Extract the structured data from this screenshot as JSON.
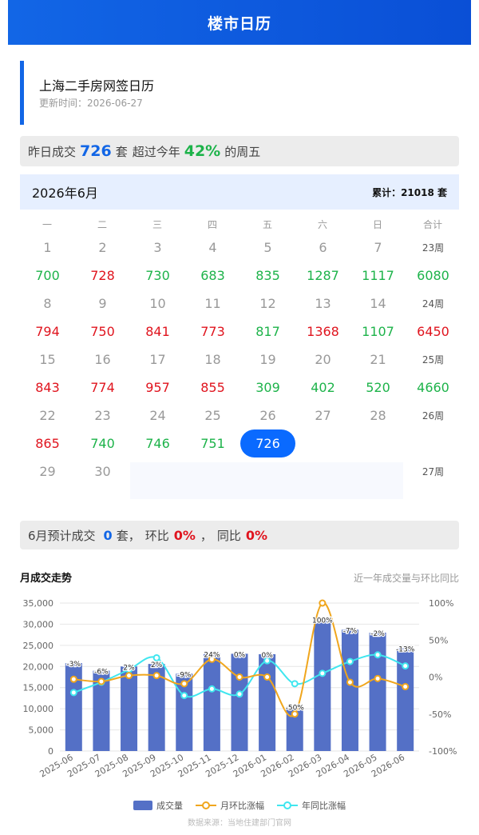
{
  "header": {
    "title": "楼市日历"
  },
  "title_card": {
    "title": "上海二手房网签日历",
    "updated": "更新时间：2026-06-27"
  },
  "summary": {
    "prefix": "昨日成交",
    "count": "726",
    "unit": "套",
    "mid": "超过今年",
    "percent": "42%",
    "suffix": "的周五"
  },
  "calendar": {
    "month": "2026年6月",
    "total": "累计：21018 套",
    "weekdays": [
      "一",
      "二",
      "三",
      "四",
      "五",
      "六",
      "日",
      "合计"
    ],
    "weeks": [
      {
        "days": [
          "1",
          "2",
          "3",
          "4",
          "5",
          "6",
          "7"
        ],
        "label": "23周",
        "values": [
          "700",
          "728",
          "730",
          "683",
          "835",
          "1287",
          "1117",
          "6080"
        ],
        "colors": [
          "green",
          "red",
          "green",
          "green",
          "green",
          "green",
          "green",
          "green"
        ]
      },
      {
        "days": [
          "8",
          "9",
          "10",
          "11",
          "12",
          "13",
          "14"
        ],
        "label": "24周",
        "values": [
          "794",
          "750",
          "841",
          "773",
          "817",
          "1368",
          "1107",
          "6450"
        ],
        "colors": [
          "red",
          "red",
          "red",
          "red",
          "green",
          "red",
          "green",
          "red"
        ]
      },
      {
        "days": [
          "15",
          "16",
          "17",
          "18",
          "19",
          "20",
          "21"
        ],
        "label": "25周",
        "values": [
          "843",
          "774",
          "957",
          "855",
          "309",
          "402",
          "520",
          "4660"
        ],
        "colors": [
          "red",
          "red",
          "red",
          "red",
          "green",
          "green",
          "green",
          "green"
        ]
      },
      {
        "days": [
          "22",
          "23",
          "24",
          "25",
          "26",
          "27",
          "28"
        ],
        "label": "26周",
        "values": [
          "865",
          "740",
          "746",
          "751",
          "726",
          "",
          "",
          ""
        ],
        "colors": [
          "red",
          "green",
          "green",
          "green",
          "selected",
          "",
          "",
          ""
        ]
      },
      {
        "days": [
          "29",
          "30",
          "",
          "",
          "",
          "",
          "",
          ""
        ],
        "label": "27周",
        "values": [],
        "colors": []
      }
    ]
  },
  "forecast": {
    "prefix": "6月预计成交",
    "count": "0",
    "unit": "套，",
    "mom_label": "环比",
    "mom": "0%",
    "sep": "，",
    "yoy_label": "同比",
    "yoy": "0%"
  },
  "chart_section": {
    "title": "月成交走势",
    "subtitle": "近一年成交量与环比同比"
  },
  "chart_data": {
    "type": "bar",
    "categories": [
      "2025-06",
      "2025-07",
      "2025-08",
      "2025-09",
      "2025-10",
      "2025-11",
      "2025-12",
      "2026-01",
      "2026-02",
      "2026-03",
      "2026-04",
      "2026-05",
      "2026-06"
    ],
    "series": [
      {
        "name": "成交量",
        "type": "bar",
        "values": [
          20800,
          19000,
          20000,
          20600,
          18300,
          23000,
          23000,
          22900,
          10500,
          31100,
          28700,
          28000,
          24300
        ]
      },
      {
        "name": "月环比涨幅",
        "type": "line",
        "axis": "right",
        "values": [
          -3,
          -6,
          2,
          2,
          -9,
          24,
          0,
          0,
          -50,
          100,
          -7,
          -2,
          -13
        ]
      },
      {
        "name": "年同比涨幅",
        "type": "line",
        "axis": "right",
        "values": [
          -21,
          -7,
          10,
          26,
          -25,
          -16,
          -23,
          22,
          -9,
          5,
          21,
          30,
          15
        ]
      }
    ],
    "bar_labels": [
      "-3%",
      "-6%",
      "2%",
      "2%",
      "-9%",
      "24%",
      "0%",
      "0%",
      "-50%",
      "100%",
      "-7%",
      "-2%",
      "-13%"
    ],
    "yticks_left": [
      "35,000",
      "30,000",
      "25,000",
      "20,000",
      "15,000",
      "10,000",
      "5,000",
      "0"
    ],
    "yticks_right": [
      "100%",
      "50%",
      "0%",
      "-50%",
      "-100%"
    ],
    "ylim_left": [
      0,
      35000
    ],
    "ylim_right": [
      -100,
      100
    ],
    "grid": true,
    "legend_position": "bottom",
    "colors": {
      "bar": "#5470c6",
      "mom": "#f0a61d",
      "yoy": "#3fe6ef"
    }
  },
  "source": "数据来源：当地住建部门官网"
}
